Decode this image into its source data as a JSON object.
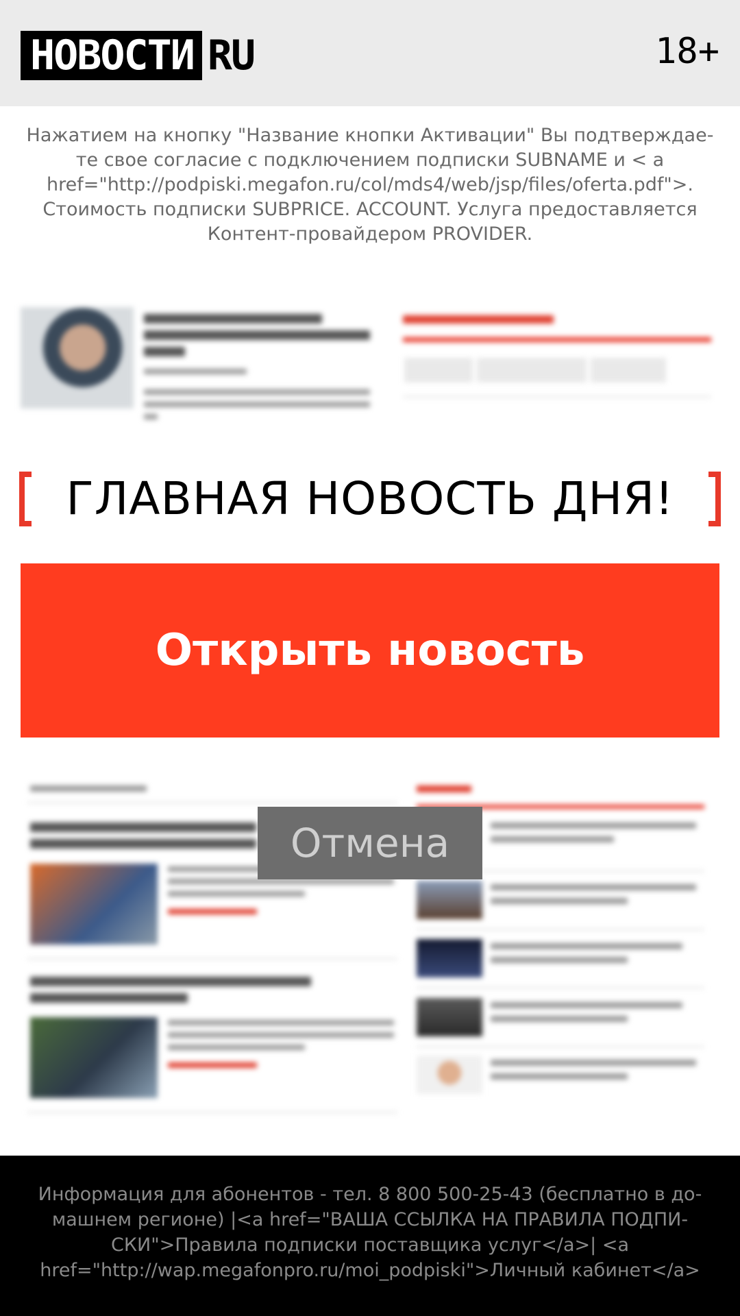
{
  "header": {
    "logo_main": "НОВОСТИ",
    "logo_suffix": "RU",
    "age_rating": "18+"
  },
  "legal_top": "Нажатием на кнопку \"Название кнопки Активации\" Вы подтверждае-те свое согласие с подключением подписки SUBNAME и < a href=\"http://podpiski.megafon.ru/col/mds4/web/jsp/files/oferta.pdf\">. Стоимость подписки SUBPRICE. ACCOUNT. Услуга предоставляется Контент-провайдером PROVIDER.",
  "main_news_label": "ГЛАВНАЯ НОВОСТЬ ДНЯ!",
  "open_button_label": "Открыть новость",
  "cancel_button_label": "Отмена",
  "footer_text": "Информация для абонентов - тел. 8 800 500-25-43 (бесплатно в до-машнем регионе) |<a href=\"ВАША ССЫЛКА НА ПРАВИЛА ПОДПИ-СКИ\">Правила подписки поставщика услуг</a>| <a href=\"http://wap.megafonpro.ru/moi_podpiski\">Личный кабинет</a>",
  "colors": {
    "accent": "#ff3c1f",
    "header_bg": "#ebebeb",
    "footer_bg": "#000000",
    "cancel_bg": "#6d6d6d"
  }
}
